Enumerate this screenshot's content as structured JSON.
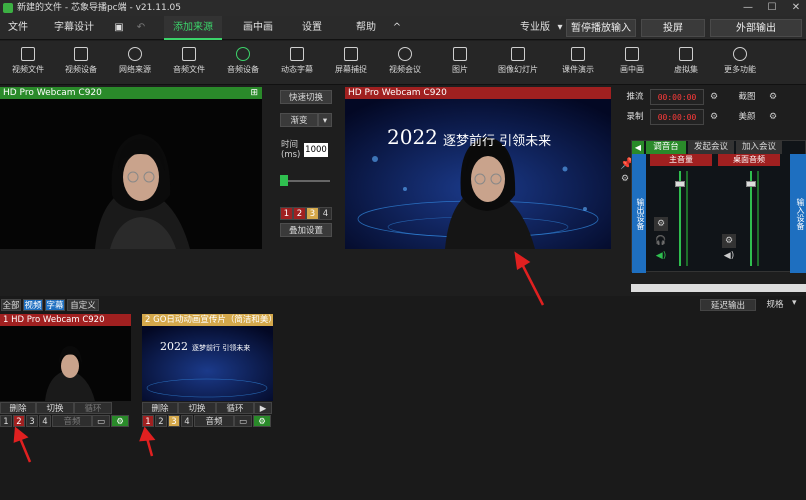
{
  "window": {
    "title": "新建的文件 - 芯象导播pc端 - v21.11.05",
    "controls": [
      "—",
      "☐",
      "✕"
    ]
  },
  "menubar": {
    "file": "文件",
    "subtitle_design": "字幕设计",
    "add_source": "添加来源",
    "pip": "画中画",
    "settings": "设置",
    "help": "帮助",
    "collapse": "^",
    "edition": "专业版",
    "pause_input": "暂停播放输入",
    "project": "投屏",
    "external_output": "外部输出"
  },
  "toolbar": [
    "视频文件",
    "视频设备",
    "网络来源",
    "音频文件",
    "音频设备",
    "动态字幕",
    "屏幕捕捉",
    "视频会议",
    "图片",
    "图像幻灯片",
    "课件演示",
    "画中画",
    "虚拟集",
    "更多功能"
  ],
  "left_preview": {
    "title": "HD Pro Webcam C920"
  },
  "controls": {
    "quick_switch": "快速切换",
    "transition": "渐变",
    "time_label": "时间\n(ms)",
    "time_value": "1000",
    "slots": [
      "1",
      "2",
      "3",
      "4"
    ],
    "stack_settings": "叠加设置"
  },
  "right_preview": {
    "title": "HD Pro Webcam C920",
    "banner_year": "2022",
    "banner_text": "逐梦前行 引领未来"
  },
  "recording": {
    "stream_label": "推流",
    "stream_time": "00:00:00",
    "record_label": "录制",
    "record_time": "00:00:00",
    "screenshot": "截图",
    "beauty": "美颜"
  },
  "mixer": {
    "tabs": [
      "调音台",
      "发起会议",
      "加入会议"
    ],
    "output_device": "输出设备",
    "input_device": "输入设备",
    "main_volume": "主音量",
    "desktop_audio": "桌面音频"
  },
  "bottom": {
    "filters": [
      "全部",
      "视频",
      "字幕",
      "自定义"
    ],
    "delay_output": "延迟输出",
    "spec": "规格",
    "cards": [
      {
        "title": "1 HD Pro Webcam C920",
        "buttons": [
          "删除",
          "切换",
          "循环"
        ],
        "nums": [
          "1",
          "2",
          "3",
          "4"
        ],
        "audio": "音频"
      },
      {
        "title": "2 GO日动动画宣传片（简洁和美）",
        "buttons": [
          "删除",
          "切换",
          "循环"
        ],
        "nums": [
          "1",
          "2",
          "3",
          "4"
        ],
        "audio": "音频",
        "banner_year": "2022",
        "banner_text": "逐梦前行 引领未来"
      }
    ]
  },
  "colors": {
    "accent_green": "#3cd26a",
    "header_red": "#a02020",
    "header_green": "#2a8a2a",
    "blue": "#1e6fc0",
    "arrow_red": "#e02020"
  }
}
